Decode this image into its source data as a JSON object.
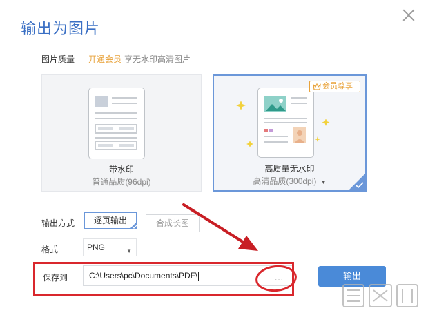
{
  "dialog": {
    "title": "输出为图片"
  },
  "quality": {
    "label": "图片质量",
    "vip_link": "开通会员",
    "vip_hint": "享无水印高清图片",
    "options": [
      {
        "title": "带水印",
        "subtitle": "普通品质(96dpi)",
        "selected": false
      },
      {
        "title": "高质量无水印",
        "subtitle": "高清品质(300dpi)",
        "badge": "会员尊享",
        "selected": true
      }
    ]
  },
  "output_mode": {
    "label": "输出方式",
    "options": [
      "逐页输出",
      "合成长图"
    ],
    "selected": "逐页输出"
  },
  "format": {
    "label": "格式",
    "value": "PNG"
  },
  "save_to": {
    "label": "保存到",
    "path": "C:\\Users\\pc\\Documents\\PDF\\",
    "browse_label": "..."
  },
  "export_label": "输出",
  "colors": {
    "accent": "#4a8ad8",
    "vip": "#e8a23a",
    "annotation": "#d9272d"
  }
}
